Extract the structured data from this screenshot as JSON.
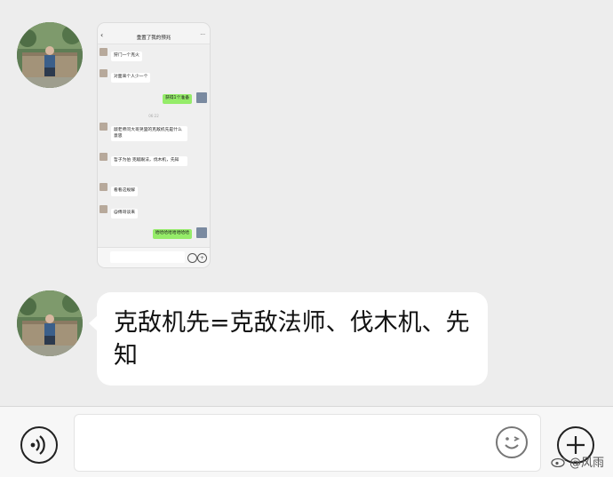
{
  "chat": {
    "image_message": {
      "title": "重置了我的预兆",
      "time": "06:22",
      "messages": [
        {
          "side": "left",
          "text": "狩门一个克火"
        },
        {
          "side": "left",
          "text": "对面来个人少一个"
        },
        {
          "side": "right",
          "text": "获得1个准备"
        },
        {
          "side": "left",
          "text": "敲老师问大哥哭里的克敌机先是什么意思"
        },
        {
          "side": "left",
          "text": "哲子为伯 克敌跟法，伐木机，先知"
        },
        {
          "side": "left",
          "text": "看看这规解"
        },
        {
          "side": "left",
          "text": "@傅哥谈来"
        },
        {
          "side": "right",
          "text": "哈哈哈哈哈哈哈哈"
        }
      ]
    },
    "text_message": "克敌机先=克敌法师、伐木机、先知"
  },
  "input_bar": {
    "placeholder": ""
  },
  "watermark": "@风雨",
  "colors": {
    "background": "#ededed",
    "bubble": "#ffffff",
    "sent_bubble": "#95ec69"
  },
  "icons": {
    "voice": "voice-icon",
    "emoji": "emoji-icon",
    "plus": "plus-icon",
    "weibo": "weibo-logo-icon"
  }
}
